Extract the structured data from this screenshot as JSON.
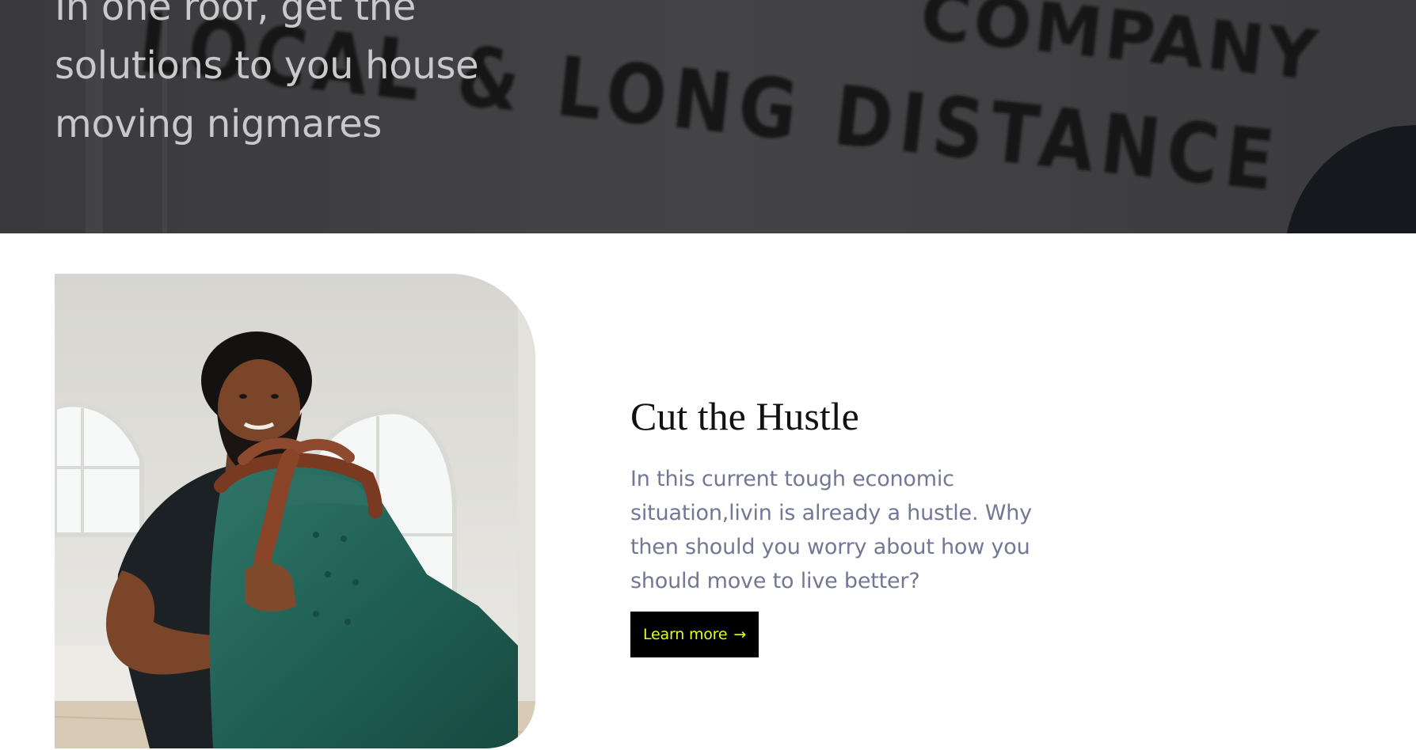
{
  "hero": {
    "headline": "In one roof, get the solutions to you house moving nigmares",
    "sign_line_1": "COMPANY",
    "sign_line_2": "LOCAL & LONG DISTANCE"
  },
  "feature": {
    "title": "Cut the Hustle",
    "body": "In this current tough economic situation,livin is already a hustle. Why then should you worry about how you should move to live better?",
    "cta_label": "Learn more",
    "cta_arrow": "→"
  },
  "colors": {
    "hero_overlay": "#3d3d3f",
    "body_text": "#727795",
    "cta_background": "#000000",
    "cta_text": "#dcff1f"
  }
}
